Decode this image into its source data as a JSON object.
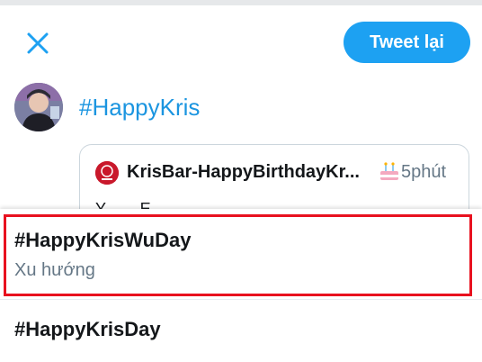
{
  "header": {
    "close_icon": "close-icon",
    "tweet_button_label": "Tweet lại",
    "accent_color": "#1da1f2"
  },
  "composer": {
    "avatar_icon": "avatar",
    "text": "#HappyKris"
  },
  "quoted_tweet": {
    "author": "KrisBar-HappyBirthdayKr...",
    "time": "5phút",
    "second_line": "Y  · · ·   E · · · · · ·"
  },
  "suggestions": [
    {
      "tag": "#HappyKrisWuDay",
      "subtitle": "Xu hướng"
    },
    {
      "tag": "#HappyKrisDay"
    }
  ],
  "highlight_color": "#e8111f"
}
